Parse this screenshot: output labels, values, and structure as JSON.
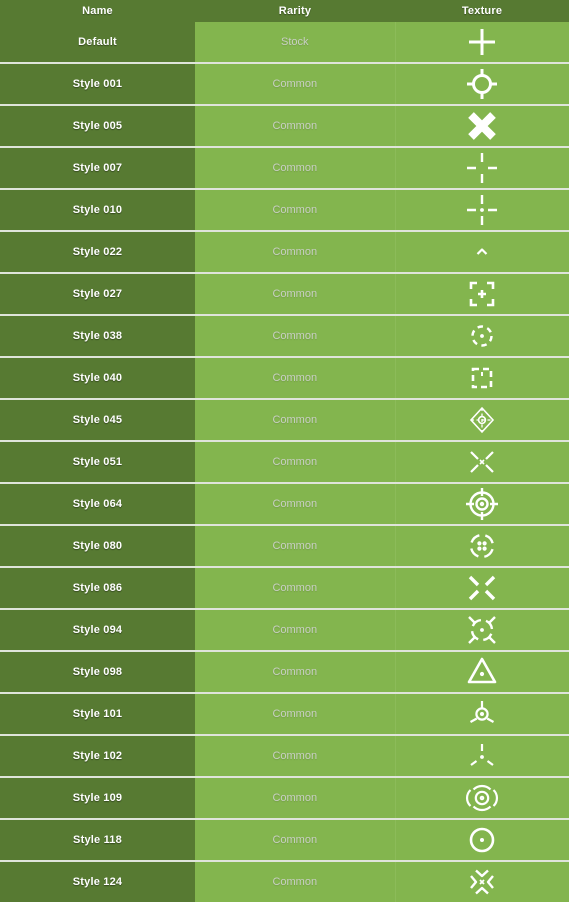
{
  "table": {
    "columns": [
      {
        "key": "name",
        "label": "Name"
      },
      {
        "key": "rarity",
        "label": "Rarity"
      },
      {
        "key": "texture",
        "label": "Texture"
      }
    ],
    "colors": {
      "header_bg": "#577a32",
      "name_cell_bg": "#577a32",
      "rarity_cell_bg": "#83b54e",
      "texture_cell_bg": "#83b54e",
      "row_divider": "#dfe4da",
      "header_text": "#ffffff",
      "name_text": "#ffffff",
      "rarity_text": "#c9cfc4",
      "icon_color": "#ffffff"
    },
    "rows": [
      {
        "name": "Default",
        "rarity": "Stock",
        "texture_icon": "plus-crosshair-icon"
      },
      {
        "name": "Style 001",
        "rarity": "Common",
        "texture_icon": "circle-ticks-crosshair-icon"
      },
      {
        "name": "Style 005",
        "rarity": "Common",
        "texture_icon": "thick-x-cross-icon"
      },
      {
        "name": "Style 007",
        "rarity": "Common",
        "texture_icon": "gapped-crosshair-icon"
      },
      {
        "name": "Style 010",
        "rarity": "Common",
        "texture_icon": "gapped-crosshair-dot-icon"
      },
      {
        "name": "Style 022",
        "rarity": "Common",
        "texture_icon": "small-chevron-up-icon"
      },
      {
        "name": "Style 027",
        "rarity": "Common",
        "texture_icon": "corner-brackets-plus-icon"
      },
      {
        "name": "Style 038",
        "rarity": "Common",
        "texture_icon": "dashed-circle-dot-icon"
      },
      {
        "name": "Style 040",
        "rarity": "Common",
        "texture_icon": "dashed-square-bracket-icon"
      },
      {
        "name": "Style 045",
        "rarity": "Common",
        "texture_icon": "diamond-crosshair-icon"
      },
      {
        "name": "Style 051",
        "rarity": "Common",
        "texture_icon": "diagonal-x-small-icon"
      },
      {
        "name": "Style 064",
        "rarity": "Common",
        "texture_icon": "double-circle-crosshair-icon"
      },
      {
        "name": "Style 080",
        "rarity": "Common",
        "texture_icon": "dashed-circle-four-dots-icon"
      },
      {
        "name": "Style 086",
        "rarity": "Common",
        "texture_icon": "thick-diagonal-x-icon"
      },
      {
        "name": "Style 094",
        "rarity": "Common",
        "texture_icon": "circle-diagonal-ticks-icon"
      },
      {
        "name": "Style 098",
        "rarity": "Common",
        "texture_icon": "triangle-dot-icon"
      },
      {
        "name": "Style 101",
        "rarity": "Common",
        "texture_icon": "circle-three-spokes-icon"
      },
      {
        "name": "Style 102",
        "rarity": "Common",
        "texture_icon": "three-radiating-dashes-icon"
      },
      {
        "name": "Style 109",
        "rarity": "Common",
        "texture_icon": "concentric-parentheses-icon"
      },
      {
        "name": "Style 118",
        "rarity": "Common",
        "texture_icon": "circle-center-dot-icon"
      },
      {
        "name": "Style 124",
        "rarity": "Common",
        "texture_icon": "x-chevrons-icon"
      }
    ]
  }
}
